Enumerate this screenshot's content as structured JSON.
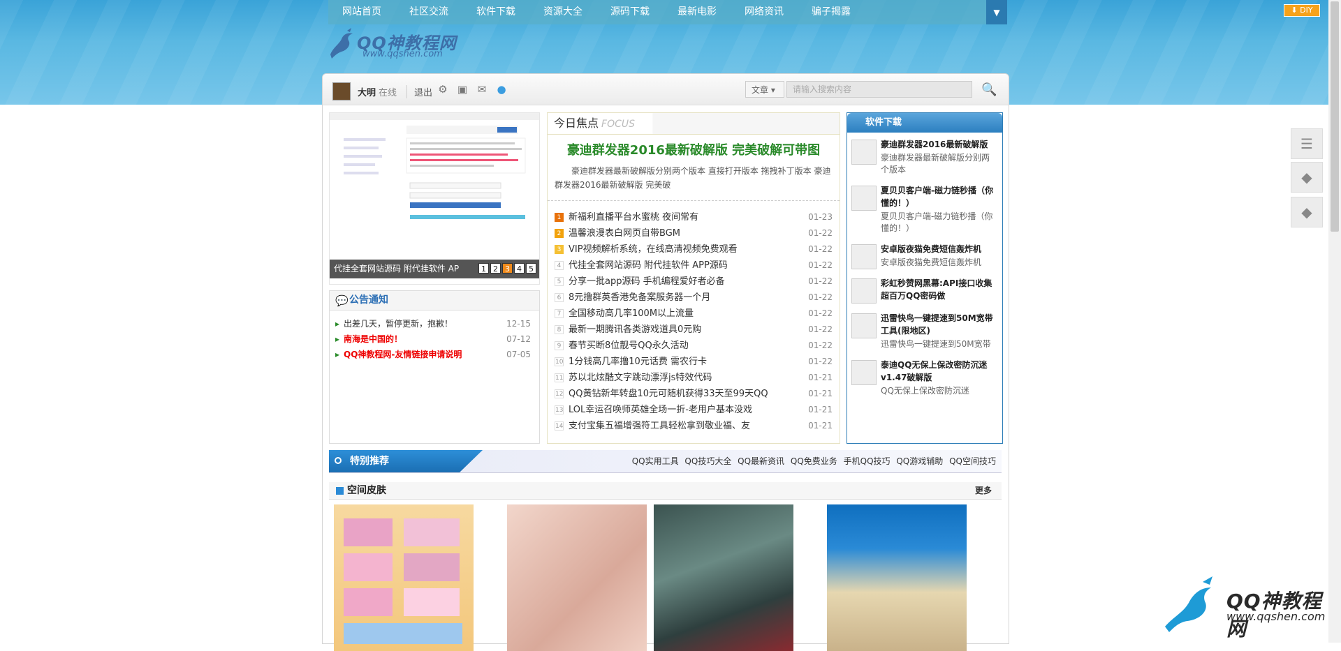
{
  "nav": {
    "items": [
      "网站首页",
      "社区交流",
      "软件下载",
      "资源大全",
      "源码下载",
      "最新电影",
      "网络资讯",
      "骗子揭露"
    ],
    "expand_icon": "chevron-down-icon"
  },
  "diy_label": "DIY",
  "logo": {
    "title": "QQ神教程网",
    "url": "www.qqshen.com"
  },
  "userbar": {
    "name": "大明",
    "status": "在线",
    "logout": "退出",
    "icons": [
      "gear-icon",
      "image-icon",
      "mail-icon",
      "bulb-icon"
    ],
    "search_type": "文章",
    "search_placeholder": "请输入搜索内容"
  },
  "slideshow": {
    "caption": "代挂全套网站源码 附代挂软件 AP",
    "pages": [
      "1",
      "2",
      "3",
      "4",
      "5"
    ],
    "active_page": "3"
  },
  "notice": {
    "title": "公告通知",
    "items": [
      {
        "text": "出差几天，暂停更新，抱歉！",
        "date": "12-15",
        "red": false
      },
      {
        "text": "南海是中国的！",
        "date": "07-12",
        "red": true
      },
      {
        "text": "QQ神教程网-友情链接申请说明",
        "date": "07-05",
        "red": true
      }
    ]
  },
  "focus": {
    "title": "今日焦点",
    "title_en": "FOCUS",
    "headline": "豪迪群发器2016最新破解版 完美破解可带图",
    "summary": "豪迪群发器最新破解版分别两个版本 直接打开版本 拖拽补丁版本 豪迪群发器2016最新破解版 完美破",
    "items": [
      {
        "n": "1",
        "text": "新福利直播平台水蜜桃 夜间常有",
        "date": "01-23"
      },
      {
        "n": "2",
        "text": "温馨浪漫表白网页自带BGM",
        "date": "01-22"
      },
      {
        "n": "3",
        "text": "VIP视频解析系统，在线高清视频免费观看",
        "date": "01-22"
      },
      {
        "n": "4",
        "text": "代挂全套网站源码 附代挂软件 APP源码",
        "date": "01-22"
      },
      {
        "n": "5",
        "text": "分享一批app源码 手机编程爱好者必备",
        "date": "01-22"
      },
      {
        "n": "6",
        "text": "8元撸群英香港免备案服务器一个月",
        "date": "01-22"
      },
      {
        "n": "7",
        "text": "全国移动高几率100M以上流量",
        "date": "01-22"
      },
      {
        "n": "8",
        "text": "最新一期腾讯各类游戏道具0元购",
        "date": "01-22"
      },
      {
        "n": "9",
        "text": "春节买断8位靓号QQ永久活动",
        "date": "01-22"
      },
      {
        "n": "10",
        "text": "1分钱高几率撸10元话费 需农行卡",
        "date": "01-22"
      },
      {
        "n": "11",
        "text": "苏以北炫酷文字跳动漂浮js特效代码",
        "date": "01-21"
      },
      {
        "n": "12",
        "text": "QQ黄钻新年转盘10元可随机获得33天至99天QQ",
        "date": "01-21"
      },
      {
        "n": "13",
        "text": "LOL幸运召唤师英雄全场一折-老用户基本没戏",
        "date": "01-21"
      },
      {
        "n": "14",
        "text": "支付宝集五福增强符工具轻松拿到敬业福、友",
        "date": "01-21"
      }
    ]
  },
  "software": {
    "title": "软件下载",
    "items": [
      {
        "title": "豪迪群发器2016最新破解版",
        "desc": "豪迪群发器最新破解版分别两个版本"
      },
      {
        "title": "夏贝贝客户端-磁力链秒播（你懂的！）",
        "desc": "夏贝贝客户端-磁力链秒播（你懂的！）"
      },
      {
        "title": "安卓版夜猫免费短信轰炸机",
        "desc": "安卓版夜猫免费短信轰炸机"
      },
      {
        "title": "彩虹秒赞网黑幕:API接口收集超百万QQ密码做",
        "desc": ""
      },
      {
        "title": "迅雷快鸟一键提速到50M宽带工具(限地区)",
        "desc": "迅雷快鸟一键提速到50M宽带"
      },
      {
        "title": "泰迪QQ无保上保改密防沉迷v1.47破解版",
        "desc": "QQ无保上保改密防沉迷"
      }
    ]
  },
  "recommend": {
    "title": "特别推荐",
    "links": [
      "QQ实用工具",
      "QQ技巧大全",
      "QQ最新资讯",
      "QQ免费业务",
      "手机QQ技巧",
      "QQ游戏辅助",
      "QQ空间技巧"
    ]
  },
  "skins": {
    "title": "空间皮肤",
    "more": "更多"
  },
  "watermark": {
    "title": "QQ神教程网",
    "url": "www.qqshen.com"
  }
}
